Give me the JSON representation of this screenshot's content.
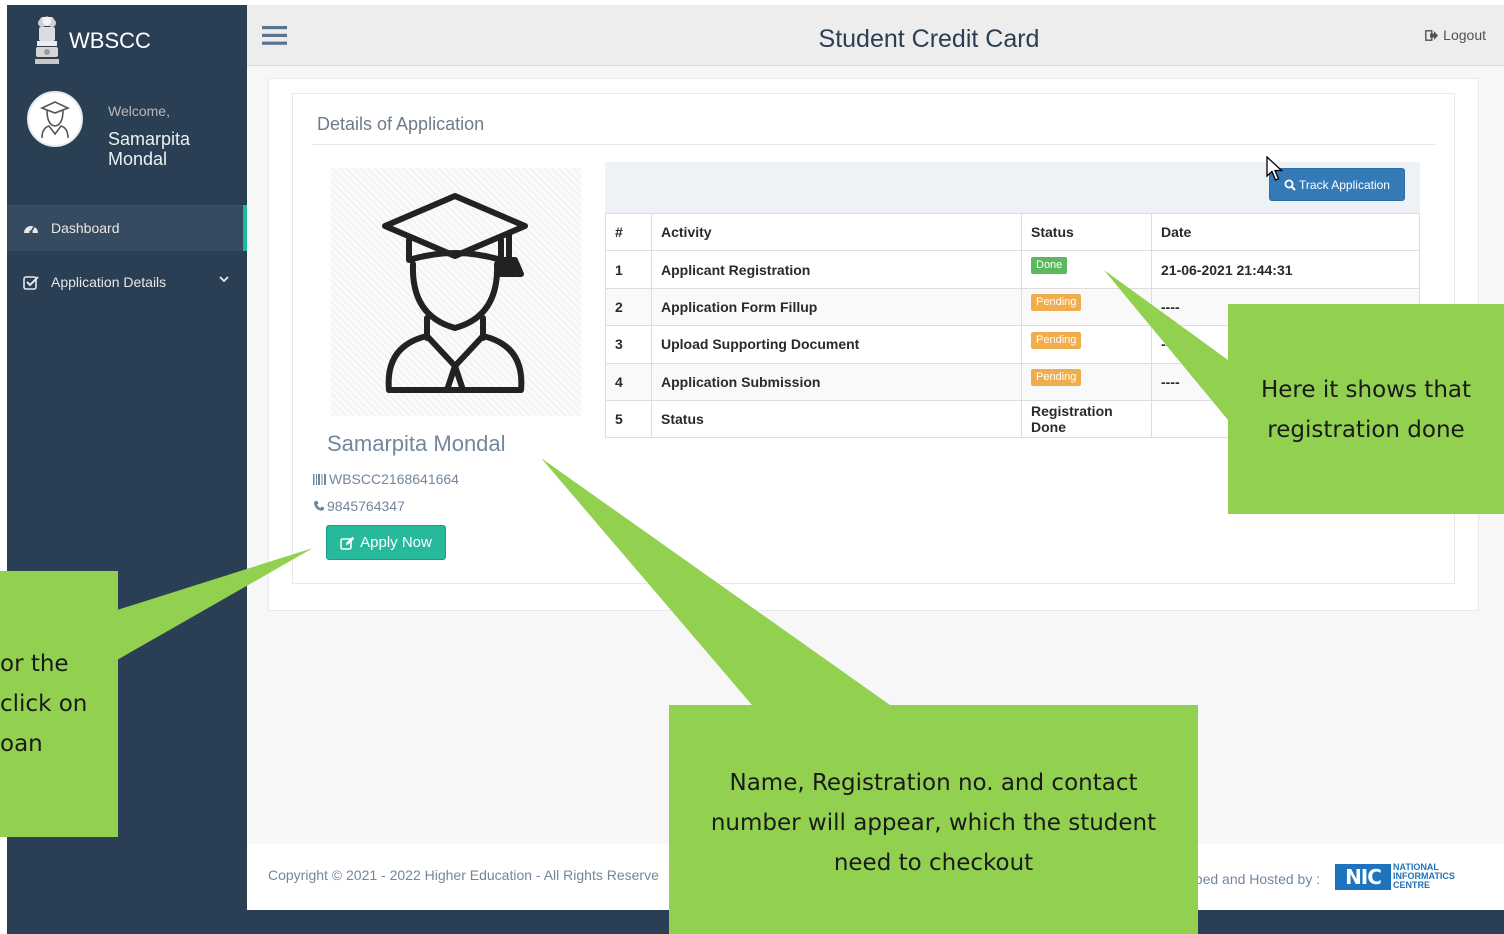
{
  "sidebar": {
    "brand": "WBSCC",
    "welcome": "Welcome,",
    "user_name": "Samarpita Mondal",
    "nav": [
      {
        "label": "Dashboard",
        "icon": "tachometer-icon",
        "active": true
      },
      {
        "label": "Application Details",
        "icon": "check-square-icon",
        "active": false
      }
    ]
  },
  "header": {
    "title": "Student Credit Card",
    "logout_label": "Logout"
  },
  "main": {
    "panel_title": "Details of Application",
    "profile": {
      "name": "Samarpita Mondal",
      "registration_no": "WBSCC2168641664",
      "phone": "9845764347",
      "apply_label": "Apply Now"
    },
    "track_label": "Track Application",
    "table": {
      "headers": [
        "#",
        "Activity",
        "Status",
        "Date"
      ],
      "rows": [
        {
          "no": "1",
          "activity": "Applicant Registration",
          "status": "Done",
          "status_kind": "done",
          "date": "21-06-2021 21:44:31"
        },
        {
          "no": "2",
          "activity": "Application Form Fillup",
          "status": "Pending",
          "status_kind": "pending",
          "date": "----"
        },
        {
          "no": "3",
          "activity": "Upload Supporting Document",
          "status": "Pending",
          "status_kind": "pending",
          "date": "----"
        },
        {
          "no": "4",
          "activity": "Application Submission",
          "status": "Pending",
          "status_kind": "pending",
          "date": "----"
        },
        {
          "no": "5",
          "activity": "Status",
          "status": "Registration Done",
          "status_kind": "text",
          "date": ""
        }
      ]
    }
  },
  "footer": {
    "copyright": "Copyright © 2021 - 2022 Higher Education - All Rights Reserve",
    "hosted": "oped and Hosted by :",
    "nic_box": "NIC",
    "nic_line1": "NATIONAL",
    "nic_line2": "INFORMATICS",
    "nic_line3": "CENTRE"
  },
  "callouts": {
    "right": "Here it shows that registration done",
    "left_lines": [
      "or the",
      " click on",
      "oan"
    ],
    "bottom": "Name, Registration no. and contact number will appear, which the student need to checkout"
  },
  "colors": {
    "sidebar": "#2a3f54",
    "accent_green": "#26b99a",
    "primary_blue": "#337ab7",
    "callout_green": "#92d050",
    "badge_done": "#5cb85c",
    "badge_pending": "#f0ad4e"
  }
}
